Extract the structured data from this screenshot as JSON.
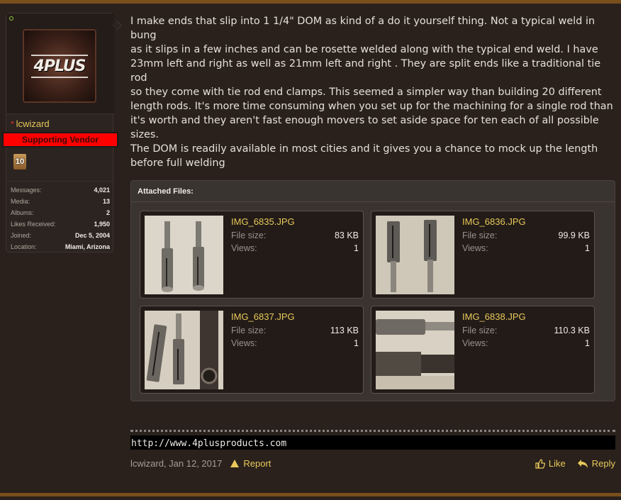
{
  "user": {
    "username": "lcwizard",
    "avatar_text": "4PLUS",
    "banner": "Supporting Vendor",
    "trophy_badge": "10",
    "stats": [
      {
        "label": "Messages:",
        "value": "4,021"
      },
      {
        "label": "Media:",
        "value": "13"
      },
      {
        "label": "Albums:",
        "value": "2"
      },
      {
        "label": "Likes Received:",
        "value": "1,950"
      },
      {
        "label": "Joined:",
        "value": "Dec 5, 2004"
      },
      {
        "label": "Location:",
        "value": "Miami, Arizona"
      }
    ]
  },
  "message": {
    "lines": [
      "I make ends that slip into 1 1/4\" DOM as kind of a do it yourself thing. Not a typical weld in bung",
      "as it slips in a few inches and can be rosette welded along with the typical end weld. I have 23mm left and right as well as 21mm left and right . They are split ends like a traditional tie rod",
      "so they come with tie rod end clamps. This seemed a simpler way than building 20 different length rods. It's more time consuming when you set up for the machining for a single rod than it's worth and they aren't fast enough movers to set aside space for ten each of all possible sizes.",
      "The DOM is readily available in most cities and it gives you a chance to mock up the length before full welding"
    ]
  },
  "attachments": {
    "title": "Attached Files:",
    "size_label": "File size:",
    "views_label": "Views:",
    "files": [
      {
        "name": "IMG_6835.JPG",
        "size": "83 KB",
        "views": "1"
      },
      {
        "name": "IMG_6836.JPG",
        "size": "99.9 KB",
        "views": "1"
      },
      {
        "name": "IMG_6837.JPG",
        "size": "113 KB",
        "views": "1"
      },
      {
        "name": "IMG_6838.JPG",
        "size": "110.3 KB",
        "views": "1"
      }
    ]
  },
  "signature": {
    "link": "http://www.4plusproducts.com"
  },
  "footer": {
    "author_date": "lcwizard, Jan 12, 2017",
    "report": "Report",
    "like": "Like",
    "reply": "Reply"
  },
  "colors": {
    "accent": "#e8c95a",
    "banner": "#ff0000",
    "background": "#2a211c"
  }
}
